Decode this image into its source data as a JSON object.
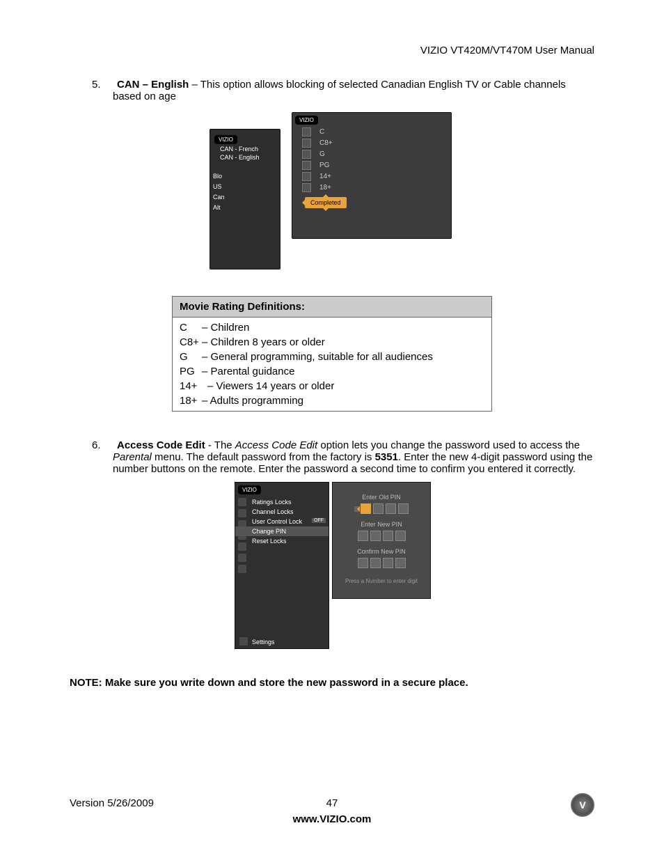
{
  "header": "VIZIO VT420M/VT470M User Manual",
  "section5": {
    "num": "5.",
    "title": "CAN – English",
    "text": " – This option allows blocking of selected Canadian English TV or Cable channels based on age"
  },
  "osd1": {
    "brand": "VIZIO",
    "back_items": [
      "CAN - French",
      "CAN - English"
    ],
    "trunc": [
      "Blo",
      "US",
      "Can",
      "Alt"
    ],
    "ratings": [
      "C",
      "C8+",
      "G",
      "PG",
      "14+",
      "18+"
    ],
    "completed": "Completed"
  },
  "def_table": {
    "title": "Movie Rating Definitions:",
    "rows": [
      {
        "r": "C",
        "d": "– Children"
      },
      {
        "r": "C8+",
        "d": "– Children 8 years or older"
      },
      {
        "r": "G",
        "d": "– General programming, suitable for all audiences"
      },
      {
        "r": "PG",
        "d": "– Parental guidance"
      },
      {
        "r": "14+",
        "d": "– Viewers 14 years or older"
      },
      {
        "r": "18+",
        "d": "– Adults programming"
      }
    ]
  },
  "section6": {
    "num": "6.",
    "title": "Access Code Edit",
    "t1": " - The ",
    "i1": "Access Code Edit",
    "t2": " option lets you change the password used to access the ",
    "i2": "Parental",
    "t3": " menu. The default password from the factory is ",
    "b1": "5351",
    "t4": ". Enter the new 4-digit password using the number buttons on the remote. Enter the password a second time to confirm you entered it correctly."
  },
  "osd2": {
    "brand": "VIZIO",
    "menu": [
      {
        "label": "Ratings Locks"
      },
      {
        "label": "Channel Locks"
      },
      {
        "label": "User Control Lock",
        "off": "OFF"
      },
      {
        "label": "Change PIN"
      },
      {
        "label": "Reset Locks"
      }
    ],
    "settings": "Settings",
    "old": "Enter Old PIN",
    "new": "Enter New PIN",
    "confirm": "Confirm New PIN",
    "hint": "Press a Number to enter digit"
  },
  "note": "NOTE:  Make sure you write down and store the new password in a secure place.",
  "footer": {
    "version": "Version 5/26/2009",
    "page": "47",
    "url": "www.VIZIO.com"
  }
}
